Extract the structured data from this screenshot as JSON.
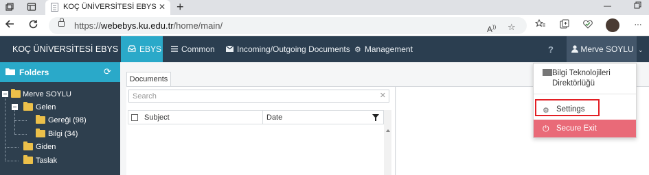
{
  "browser": {
    "tab_title": "KOÇ ÜNİVERSİTESİ EBYS",
    "url_prefix": "https://",
    "url_domain": "webebys.ku.edu.tr",
    "url_path": "/home/main/"
  },
  "app": {
    "brand": "KOÇ ÜNİVERSİTESİ EBYS",
    "nav": [
      {
        "label": "EBYS",
        "icon": "inbox-icon"
      },
      {
        "label": "Common",
        "icon": "menu-icon"
      },
      {
        "label": "Incoming/Outgoing Documents",
        "icon": "envelope-icon"
      },
      {
        "label": "Management",
        "icon": "gears-icon"
      }
    ],
    "help": "?",
    "user": "Merve SOYLU"
  },
  "sidebar": {
    "title": "Folders",
    "tree": [
      {
        "label": "Merve SOYLU"
      },
      {
        "label": "Gelen"
      },
      {
        "label": "Gereği (98)"
      },
      {
        "label": "Bilgi (34)"
      },
      {
        "label": "Giden"
      },
      {
        "label": "Taslak"
      }
    ]
  },
  "main": {
    "tab": "Documents",
    "search_placeholder": "Search",
    "columns": [
      "Subject",
      "Date"
    ]
  },
  "dropdown": {
    "org_line1": "Bilgi Teknolojileri",
    "org_line2": "Direktörlüğü",
    "settings": "Settings",
    "exit": "Secure Exit"
  },
  "colors": {
    "nav_bg": "#2b3e50",
    "accent": "#2aa9c9",
    "exit_bg": "#e96a78",
    "highlight_border": "#e31e24"
  }
}
